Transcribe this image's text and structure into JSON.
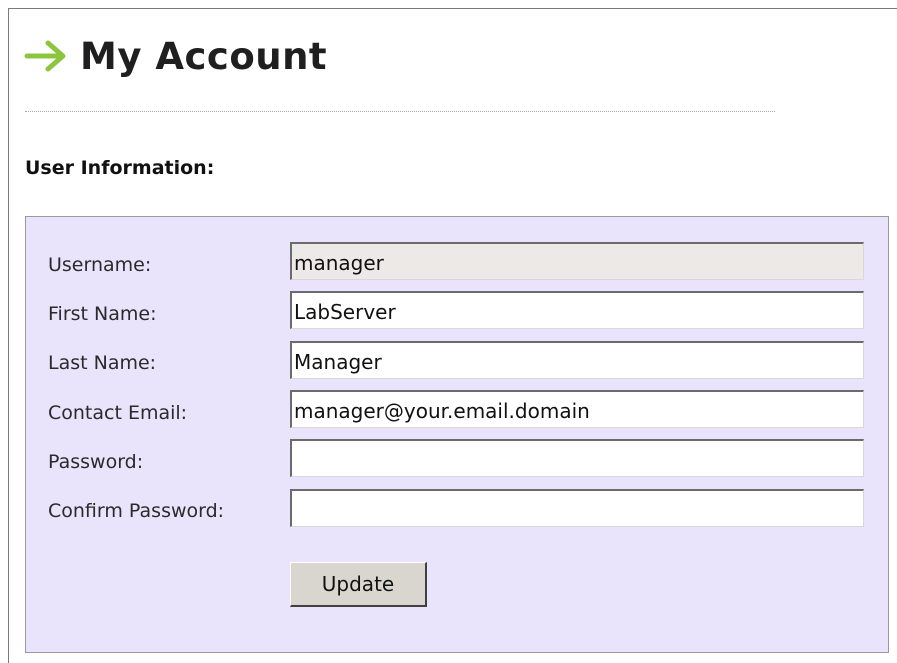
{
  "header": {
    "icon": "right-arrow-icon",
    "title": "My Account",
    "accent_color": "#8cc63f"
  },
  "section": {
    "heading": "User Information:"
  },
  "form": {
    "fields": [
      {
        "label": "Username:",
        "value": "manager",
        "readonly": true
      },
      {
        "label": "First Name:",
        "value": "LabServer",
        "readonly": false
      },
      {
        "label": "Last Name:",
        "value": "Manager",
        "readonly": false
      },
      {
        "label": "Contact Email:",
        "value": "manager@your.email.domain",
        "readonly": false
      },
      {
        "label": "Password:",
        "value": "",
        "readonly": false
      },
      {
        "label": "Confirm Password:",
        "value": "",
        "readonly": false
      }
    ],
    "submit_label": "Update",
    "panel_color": "#e9e4fc"
  }
}
